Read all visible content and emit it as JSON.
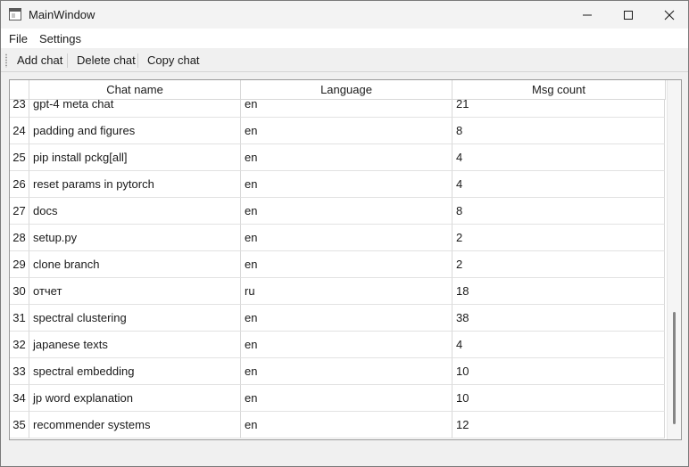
{
  "window": {
    "title": "MainWindow"
  },
  "menu": {
    "file": "File",
    "settings": "Settings"
  },
  "toolbar": {
    "add": "Add chat",
    "delete": "Delete chat",
    "copy": "Copy chat"
  },
  "table": {
    "columns": [
      "Chat name",
      "Language",
      "Msg count"
    ],
    "rows": [
      {
        "num": "23",
        "name": "gpt-4 meta chat",
        "lang": "en",
        "count": "21"
      },
      {
        "num": "24",
        "name": "padding and figures",
        "lang": "en",
        "count": "8"
      },
      {
        "num": "25",
        "name": "pip install pckg[all]",
        "lang": "en",
        "count": "4"
      },
      {
        "num": "26",
        "name": "reset params in pytorch",
        "lang": "en",
        "count": "4"
      },
      {
        "num": "27",
        "name": "docs",
        "lang": "en",
        "count": "8"
      },
      {
        "num": "28",
        "name": "setup.py",
        "lang": "en",
        "count": "2"
      },
      {
        "num": "29",
        "name": "clone branch",
        "lang": "en",
        "count": "2"
      },
      {
        "num": "30",
        "name": "отчет",
        "lang": "ru",
        "count": "18"
      },
      {
        "num": "31",
        "name": "spectral clustering",
        "lang": "en",
        "count": "38"
      },
      {
        "num": "32",
        "name": "japanese texts",
        "lang": "en",
        "count": "4"
      },
      {
        "num": "33",
        "name": "spectral embedding",
        "lang": "en",
        "count": "10"
      },
      {
        "num": "34",
        "name": "jp word explanation",
        "lang": "en",
        "count": "10"
      },
      {
        "num": "35",
        "name": "recommender systems",
        "lang": "en",
        "count": "12"
      }
    ]
  },
  "icons": {
    "app": "app-window-icon",
    "minimize": "minimize-icon",
    "maximize": "maximize-icon",
    "close": "close-icon"
  }
}
